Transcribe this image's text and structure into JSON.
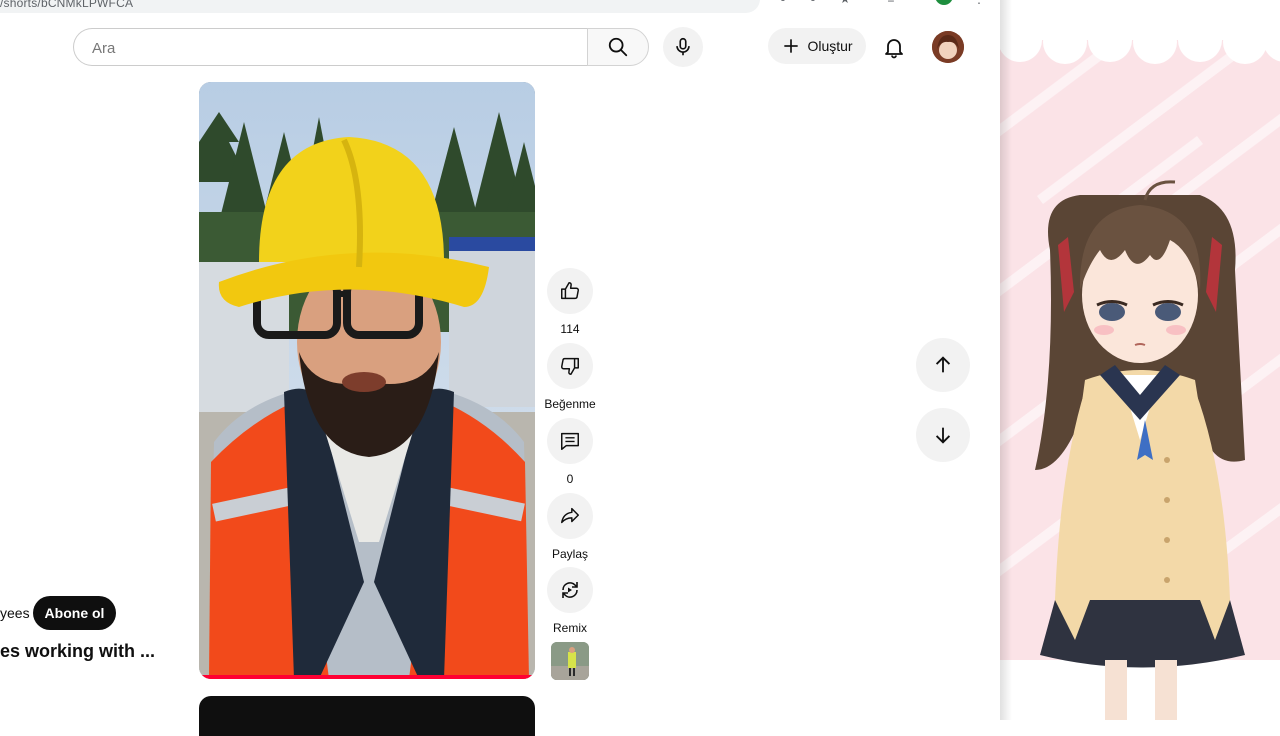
{
  "browser": {
    "url_fragment": "/shorts/bCNMkLPWFCA"
  },
  "header": {
    "search_placeholder": "Ara",
    "create_label": "Oluştur"
  },
  "short": {
    "channel_tail": "yees",
    "subscribe_label": "Abone ol",
    "title_tail": "es working with ..."
  },
  "actions": {
    "like_count": "114",
    "dislike_label": "Beğenme",
    "comment_count": "0",
    "share_label": "Paylaş",
    "remix_label": "Remix"
  },
  "colors": {
    "subscribe_bg": "#0f0f0f",
    "panel_pink": "#fbe3e7",
    "hard_hat": "#f2d21b",
    "vest": "#f24a1b"
  },
  "icons": [
    "search-icon",
    "microphone-icon",
    "plus-icon",
    "bell-icon",
    "thumbs-up-icon",
    "thumbs-down-icon",
    "comment-icon",
    "share-icon",
    "remix-icon",
    "arrow-up-icon",
    "arrow-down-icon"
  ]
}
